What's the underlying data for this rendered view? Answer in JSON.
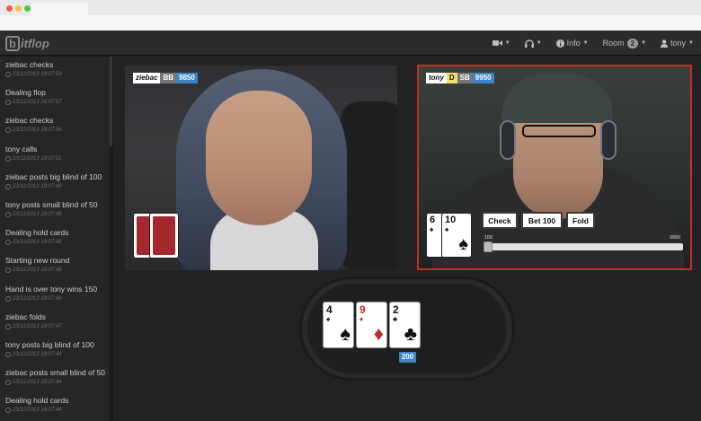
{
  "app": {
    "brand_letter": "b",
    "brand_rest": "itflop"
  },
  "nav": {
    "video_icon": "video-camera-icon",
    "audio_icon": "headphones-icon",
    "info_label": "Info",
    "room_label": "Room",
    "room_count": "2",
    "user_label": "tony"
  },
  "log": [
    {
      "text": "ziebac checks",
      "time": "23/11/2013 18:07:59"
    },
    {
      "text": "Dealing flop",
      "time": "23/11/2013 18:07:57"
    },
    {
      "text": "ziebac checks",
      "time": "23/11/2013 18:07:56"
    },
    {
      "text": "tony calls",
      "time": "23/11/2013 18:07:51"
    },
    {
      "text": "ziebac posts big blind of 100",
      "time": "23/11/2013 18:07:49"
    },
    {
      "text": "tony posts small blind of 50",
      "time": "23/11/2013 18:07:48"
    },
    {
      "text": "Dealing hold cards",
      "time": "23/11/2013 18:07:48"
    },
    {
      "text": "Starting new round",
      "time": "23/11/2013 18:07:48"
    },
    {
      "text": "Hand is over tony wins 150",
      "time": "23/11/2013 18:07:49"
    },
    {
      "text": "ziebac folds",
      "time": "23/11/2013 18:07:47"
    },
    {
      "text": "tony posts big blind of 100",
      "time": "23/11/2013 18:07:44"
    },
    {
      "text": "ziebac posts small blind of 50",
      "time": "23/11/2013 18:07:44"
    },
    {
      "text": "Dealing hold cards",
      "time": "23/11/2013 18:07:44"
    }
  ],
  "players": {
    "left": {
      "name": "ziebac",
      "position": "BB",
      "stack": "9850"
    },
    "right": {
      "name": "tony",
      "dealer": "D",
      "position": "SB",
      "stack": "9950"
    }
  },
  "hero_cards": [
    {
      "rank": "6",
      "suit": "♠"
    },
    {
      "rank": "10",
      "suit": "♠"
    }
  ],
  "actions": {
    "check": "Check",
    "bet": "Bet 100",
    "fold": "Fold"
  },
  "slider": {
    "min": "100",
    "max": "9950",
    "value": 100
  },
  "board": [
    {
      "rank": "4",
      "suit": "♠",
      "color": "#111111"
    },
    {
      "rank": "9",
      "suit": "♦",
      "color": "#c62828"
    },
    {
      "rank": "2",
      "suit": "♣",
      "color": "#111111"
    }
  ],
  "pot": "200"
}
